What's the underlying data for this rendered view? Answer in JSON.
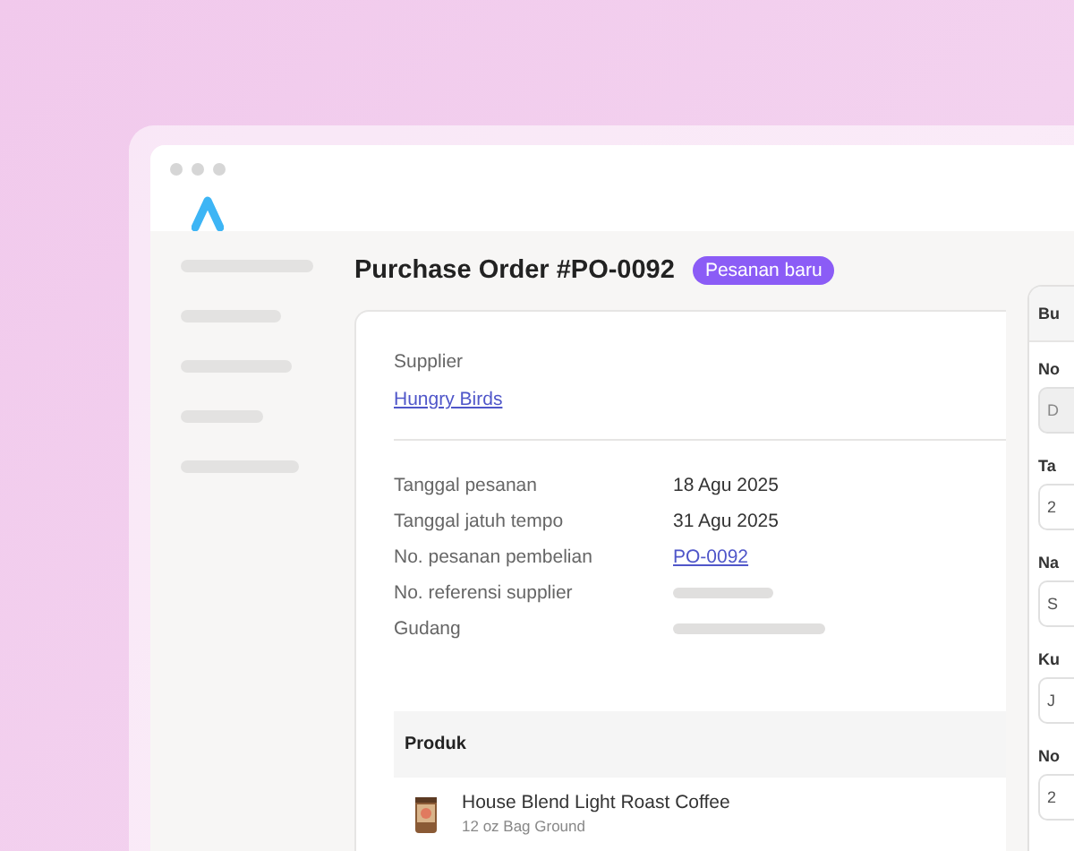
{
  "title": "Purchase Order #PO-0092",
  "status_badge": "Pesanan baru",
  "supplier": {
    "label": "Supplier",
    "value": "Hungry Birds"
  },
  "details": [
    {
      "label": "Tanggal pesanan",
      "kind": "text",
      "value": "18 Agu 2025"
    },
    {
      "label": "Tanggal jatuh tempo",
      "kind": "text",
      "value": "31 Agu 2025"
    },
    {
      "label": "No. pesanan pembelian",
      "kind": "link",
      "value": "PO-0092"
    },
    {
      "label": "No. referensi supplier",
      "kind": "skeleton"
    },
    {
      "label": "Gudang",
      "kind": "skeleton"
    }
  ],
  "products": {
    "heading": "Produk",
    "rows": [
      {
        "name": "House Blend Light Roast Coffee",
        "variant": "12 oz Bag Ground"
      }
    ]
  },
  "side_panel": {
    "title": "Bu",
    "fields": [
      {
        "label": "No",
        "value": "D",
        "disabled": true
      },
      {
        "label": "Ta",
        "value": "2",
        "disabled": false
      },
      {
        "label": "Na",
        "value": "S",
        "disabled": false
      },
      {
        "label": "Ku",
        "value": "J",
        "disabled": false
      },
      {
        "label": "No",
        "value": "2",
        "disabled": false
      }
    ]
  }
}
